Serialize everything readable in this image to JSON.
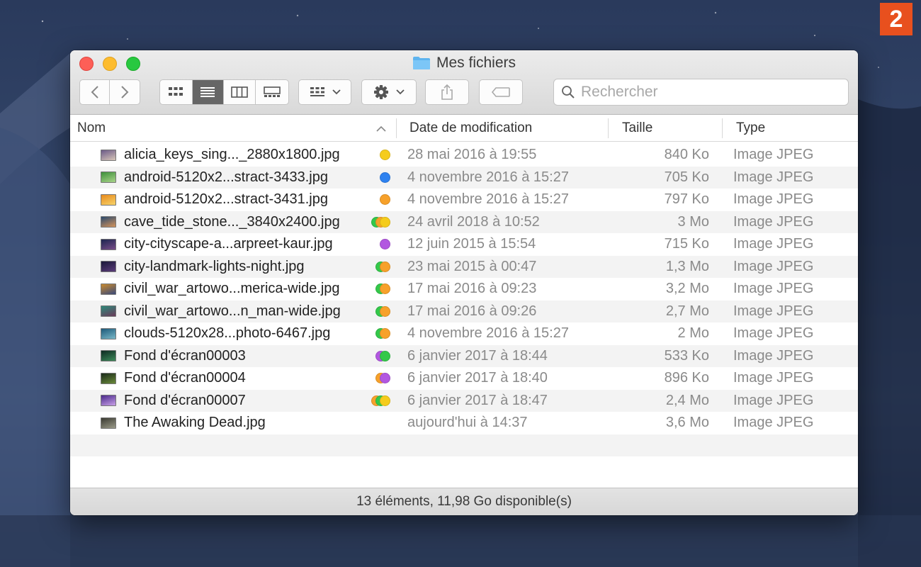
{
  "badge": "2",
  "window": {
    "title": "Mes fichiers"
  },
  "toolbar": {
    "search_placeholder": "Rechercher"
  },
  "columns": {
    "name": "Nom",
    "date": "Date de modification",
    "size": "Taille",
    "type": "Type"
  },
  "tag_colors": {
    "yellow": "#f5cc1c",
    "blue": "#2e82f0",
    "orange": "#f7a12a",
    "green": "#34c84a",
    "purple": "#b257e0"
  },
  "files": [
    {
      "name": "alicia_keys_sing..._2880x1800.jpg",
      "date": "28 mai 2016 à 19:55",
      "size": "840 Ko",
      "type": "Image JPEG",
      "tags": [
        "yellow"
      ],
      "thumb": [
        "#6b5a88",
        "#d8c6b8"
      ]
    },
    {
      "name": "android-5120x2...stract-3433.jpg",
      "date": "4 novembre 2016 à 15:27",
      "size": "705 Ko",
      "type": "Image JPEG",
      "tags": [
        "blue"
      ],
      "thumb": [
        "#3d8f3a",
        "#a9d48a"
      ]
    },
    {
      "name": "android-5120x2...stract-3431.jpg",
      "date": "4 novembre 2016 à 15:27",
      "size": "797 Ko",
      "type": "Image JPEG",
      "tags": [
        "orange"
      ],
      "thumb": [
        "#e88a1c",
        "#f6d36a"
      ]
    },
    {
      "name": "cave_tide_stone..._3840x2400.jpg",
      "date": "24 avril 2018 à 10:52",
      "size": "3 Mo",
      "type": "Image JPEG",
      "tags": [
        "green",
        "orange",
        "yellow"
      ],
      "thumb": [
        "#2a4a6e",
        "#d4935a"
      ]
    },
    {
      "name": "city-cityscape-a...arpreet-kaur.jpg",
      "date": "12 juin 2015 à 15:54",
      "size": "715 Ko",
      "type": "Image JPEG",
      "tags": [
        "purple"
      ],
      "thumb": [
        "#1c2550",
        "#7a4e8a"
      ]
    },
    {
      "name": "city-landmark-lights-night.jpg",
      "date": "23 mai 2015 à 00:47",
      "size": "1,3 Mo",
      "type": "Image JPEG",
      "tags": [
        "green",
        "orange"
      ],
      "thumb": [
        "#1a1838",
        "#5b3c7a"
      ]
    },
    {
      "name": "civil_war_artowo...merica-wide.jpg",
      "date": "17 mai 2016 à 09:23",
      "size": "3,2 Mo",
      "type": "Image JPEG",
      "tags": [
        "green",
        "orange"
      ],
      "thumb": [
        "#c98a2e",
        "#3a4a7a"
      ]
    },
    {
      "name": "civil_war_artowo...n_man-wide.jpg",
      "date": "17 mai 2016 à 09:26",
      "size": "2,7 Mo",
      "type": "Image JPEG",
      "tags": [
        "green",
        "orange"
      ],
      "thumb": [
        "#2e8a7a",
        "#6b3a5a"
      ]
    },
    {
      "name": "clouds-5120x28...photo-6467.jpg",
      "date": "4 novembre 2016 à 15:27",
      "size": "2 Mo",
      "type": "Image JPEG",
      "tags": [
        "green",
        "orange"
      ],
      "thumb": [
        "#1d5a7a",
        "#7ab8c8"
      ]
    },
    {
      "name": "Fond d'écran00003",
      "date": "6 janvier 2017 à 18:44",
      "size": "533 Ko",
      "type": "Image JPEG",
      "tags": [
        "purple",
        "green"
      ],
      "thumb": [
        "#0e2a22",
        "#3d8a5a"
      ]
    },
    {
      "name": "Fond d'écran00004",
      "date": "6 janvier 2017 à 18:40",
      "size": "896 Ko",
      "type": "Image JPEG",
      "tags": [
        "orange",
        "purple"
      ],
      "thumb": [
        "#1a2a1a",
        "#6a8a3a"
      ]
    },
    {
      "name": "Fond d'écran00007",
      "date": "6 janvier 2017 à 18:47",
      "size": "2,4 Mo",
      "type": "Image JPEG",
      "tags": [
        "orange",
        "green",
        "yellow"
      ],
      "thumb": [
        "#4a2a8a",
        "#c8a0e8"
      ]
    },
    {
      "name": "The Awaking Dead.jpg",
      "date": "aujourd'hui à 14:37",
      "size": "3,6 Mo",
      "type": "Image JPEG",
      "tags": [],
      "thumb": [
        "#3a3a32",
        "#9a9a88"
      ]
    }
  ],
  "status": "13 éléments, 11,98 Go disponible(s)"
}
